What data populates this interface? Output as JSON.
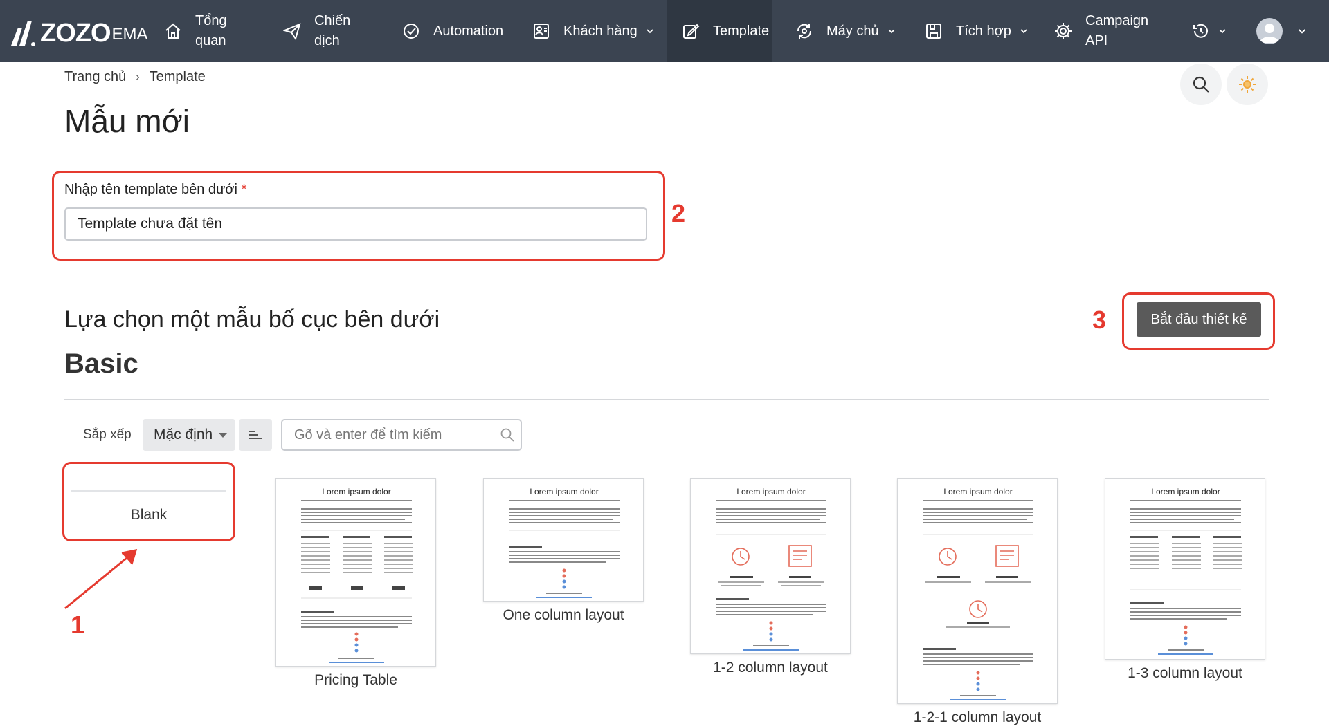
{
  "nav": {
    "logo_main": "ZOZO",
    "logo_sub": "EMA",
    "items": [
      {
        "label": "Tổng quan",
        "line1": "Tổng",
        "line2": "quan",
        "icon": "home-icon"
      },
      {
        "label": "Chiến dịch",
        "line1": "Chiến",
        "line2": "dịch",
        "icon": "paper-plane-icon"
      },
      {
        "label": "Automation",
        "icon": "check-circle-icon"
      },
      {
        "label": "Khách hàng",
        "icon": "contacts-icon",
        "dropdown": true
      },
      {
        "label": "Template",
        "icon": "edit-icon",
        "active": true
      },
      {
        "label": "Máy chủ",
        "icon": "server-sync-icon",
        "dropdown": true
      },
      {
        "label": "Tích hợp",
        "icon": "integration-icon",
        "dropdown": true
      },
      {
        "label": "Campaign API",
        "line1": "Campaign",
        "line2": "API",
        "icon": "gear-icon"
      }
    ],
    "history_icon": "history-icon",
    "avatar_icon": "user-avatar-icon",
    "colors": {
      "bar": "#3b4451",
      "active": "#2f3742"
    }
  },
  "breadcrumb": {
    "home": "Trang chủ",
    "separator": "›",
    "current": "Template"
  },
  "page": {
    "title": "Mẫu mới"
  },
  "form": {
    "label": "Nhập tên template bên dưới",
    "required_mark": "*",
    "value": "Template chưa đặt tên"
  },
  "layout_section": {
    "title": "Lựa chọn một mẫu bố cục bên dưới",
    "category": "Basic",
    "start_button": "Bắt đầu thiết kế"
  },
  "toolbar": {
    "sort_label": "Sắp xếp",
    "sort_value": "Mặc định",
    "search_placeholder": "Gõ và enter để tìm kiếm"
  },
  "callouts": {
    "one": "1",
    "two": "2",
    "three": "3",
    "color": "#e53a2f"
  },
  "templates": [
    {
      "label": "Blank"
    },
    {
      "label": "Pricing Table",
      "thumb_title": "Lorem ipsum dolor"
    },
    {
      "label": "One column layout",
      "thumb_title": "Lorem ipsum dolor"
    },
    {
      "label": "1-2 column layout",
      "thumb_title": "Lorem ipsum dolor"
    },
    {
      "label": "1-2-1 column layout",
      "thumb_title": "Lorem ipsum dolor"
    },
    {
      "label": "1-3 column layout",
      "thumb_title": "Lorem ipsum dolor"
    }
  ]
}
